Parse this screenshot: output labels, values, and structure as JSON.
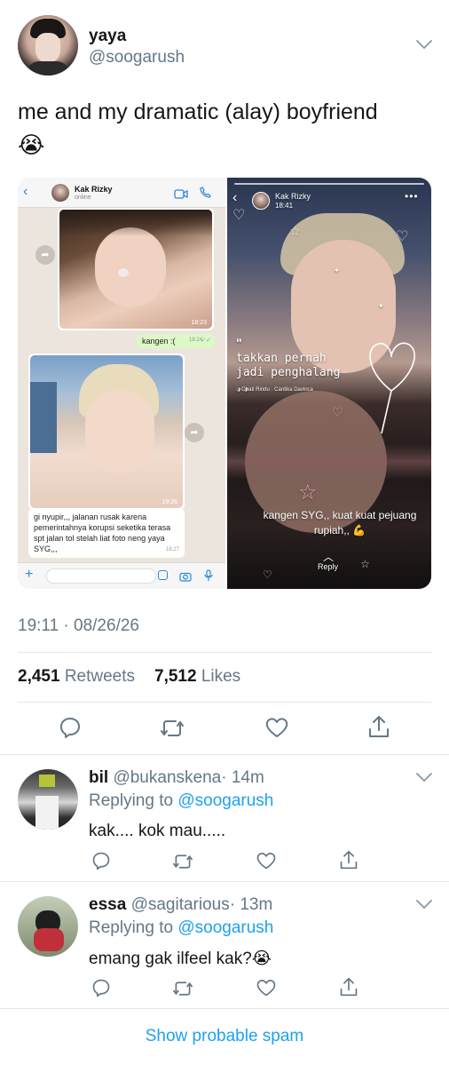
{
  "tweet": {
    "author_name": "yaya",
    "author_handle": "@soogarush",
    "text": "me and my dramatic (alay) boyfriend",
    "emoji": "😭",
    "timestamp": "19:11 · 08/26/26",
    "retweets_count": "2,451",
    "retweets_label": "Retweets",
    "likes_count": "7,512",
    "likes_label": "Likes"
  },
  "media_left": {
    "contact_name": "Kak Rizky",
    "contact_status": "online",
    "photo1_time": "18:23",
    "sent_message": "kangen :(",
    "sent_time": "18:24",
    "photo2_time": "18:26",
    "received_message": "gi nyupir,,, jalanan rusak karena pemerintahnya korupsi seketika terasa spt jalan tol stelah liat foto neng yaya SYG,,,",
    "received_time": "18:27"
  },
  "media_right": {
    "contact_name": "Kak Rizky",
    "time": "18:41",
    "lyric_quote": "\"",
    "lyric": "takkan pernah jadi penghalang ,,",
    "song": "♫ Obati Rindu · Cantika Davinca",
    "caption": "kangen SYG,, kuat kuat pejuang rupiah,, 💪",
    "reply_label": "Reply"
  },
  "replies": [
    {
      "name": "bil",
      "handle": "@bukanskena",
      "time": "· 14m",
      "replying_label": "Replying to",
      "replying_handle": "@soogarush",
      "text": "kak.... kok mau....."
    },
    {
      "name": "essa",
      "handle": "@sagitarious",
      "time": "· 13m",
      "replying_label": "Replying to",
      "replying_handle": "@soogarush",
      "text": "emang gak ilfeel kak?😭"
    }
  ],
  "footer": {
    "show_spam": "Show probable spam"
  },
  "icons": {
    "reply": "reply-icon",
    "retweet": "retweet-icon",
    "like": "heart-icon",
    "share": "share-icon",
    "more": "chevron-down-icon"
  },
  "colors": {
    "link": "#1da1f2",
    "secondary_text": "#657786",
    "divider": "#e1e8ed",
    "whatsapp_sent": "#dcf8c6"
  }
}
